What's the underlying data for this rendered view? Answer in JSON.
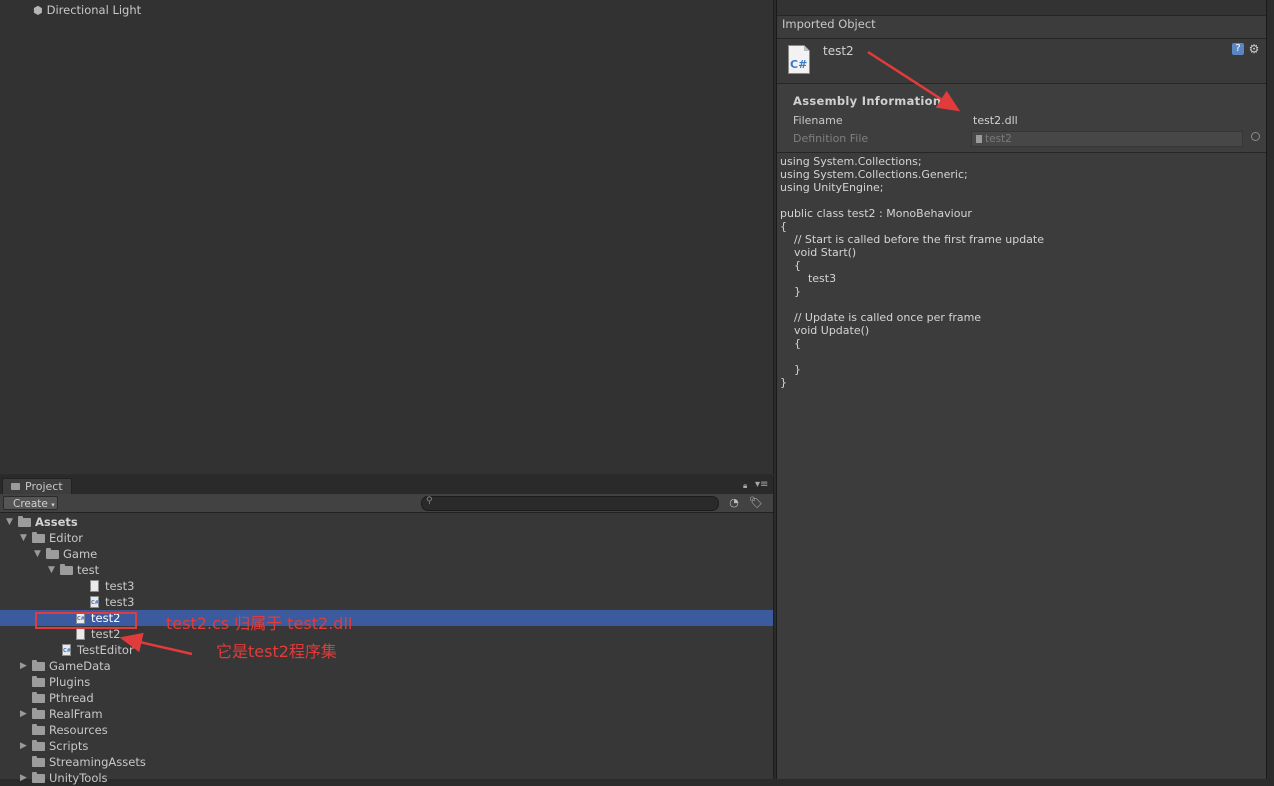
{
  "hierarchy": {
    "items": [
      {
        "label": "Directional Light",
        "icon": "gameobject-cube-icon"
      }
    ]
  },
  "inspector": {
    "title": "Imported Object",
    "asset_name": "test2",
    "asset_icon_text": "C#",
    "assembly": {
      "title": "Assembly Information",
      "filename_label": "Filename",
      "filename_value": "test2.dll",
      "definition_label": "Definition File",
      "definition_value": "test2"
    },
    "code": "using System.Collections;\nusing System.Collections.Generic;\nusing UnityEngine;\n\npublic class test2 : MonoBehaviour\n{\n    // Start is called before the first frame update\n    void Start()\n    {\n        test3\n    }\n\n    // Update is called once per frame\n    void Update()\n    {\n        \n    }\n}"
  },
  "project": {
    "tab_label": "Project",
    "create_label": "Create",
    "tree": [
      {
        "label": "Assets",
        "type": "folder",
        "depth": 0,
        "arrow": "open",
        "bold": true
      },
      {
        "label": "Editor",
        "type": "folder",
        "depth": 1,
        "arrow": "open"
      },
      {
        "label": "Game",
        "type": "folder",
        "depth": 2,
        "arrow": "open"
      },
      {
        "label": "test",
        "type": "folder",
        "depth": 3,
        "arrow": "open"
      },
      {
        "label": "test3",
        "type": "file",
        "depth": 5
      },
      {
        "label": "test3",
        "type": "cs",
        "depth": 5
      },
      {
        "label": "test2",
        "type": "cs",
        "depth": 4,
        "selected": true
      },
      {
        "label": "test2",
        "type": "file",
        "depth": 4
      },
      {
        "label": "TestEditor",
        "type": "cs",
        "depth": 3
      },
      {
        "label": "GameData",
        "type": "folder",
        "depth": 1,
        "arrow": "closed"
      },
      {
        "label": "Plugins",
        "type": "folder",
        "depth": 1
      },
      {
        "label": "Pthread",
        "type": "folder",
        "depth": 1
      },
      {
        "label": "RealFram",
        "type": "folder",
        "depth": 1,
        "arrow": "closed"
      },
      {
        "label": "Resources",
        "type": "folder",
        "depth": 1
      },
      {
        "label": "Scripts",
        "type": "folder",
        "depth": 1,
        "arrow": "closed"
      },
      {
        "label": "StreamingAssets",
        "type": "folder",
        "depth": 1
      },
      {
        "label": "UnityTools",
        "type": "folder",
        "depth": 1,
        "arrow": "closed"
      }
    ]
  },
  "annotations": {
    "note1": "test2.cs 归属于 test2.dll",
    "note2": "它是test2程序集",
    "color": "#e23b3b"
  },
  "colors": {
    "selection": "#3b5b9e",
    "accent_red": "#e23b3b"
  }
}
